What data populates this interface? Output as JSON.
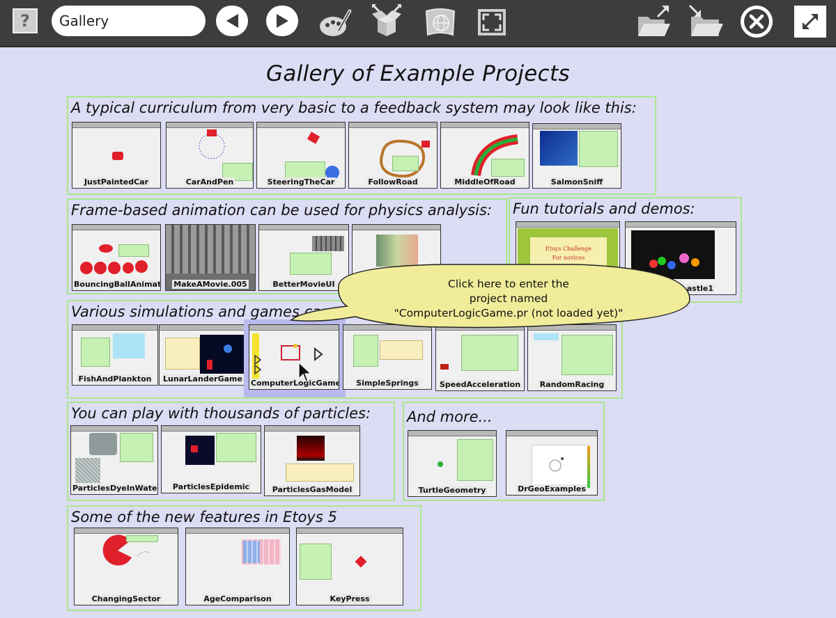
{
  "toolbar": {
    "help_label": "?",
    "project_title": "Gallery",
    "colors": {
      "background": "#3d3d3d",
      "button_fill": "#ffffff",
      "icon": "#d8d8d8"
    }
  },
  "page": {
    "title": "Gallery of Example Projects",
    "background": "#dcdcf4",
    "section_border": "#a7e88c"
  },
  "sections": [
    {
      "heading": "A typical curriculum from very basic to a feedback system may look like this:",
      "projects": [
        "JustPaintedCar",
        "CarAndPen",
        "SteeringTheCar",
        "FollowRoad",
        "MiddleOfRoad",
        "SalmonSniff"
      ]
    },
    {
      "heading": "Frame-based animation can be used for physics analysis:",
      "projects": [
        "BouncingBallAnimation",
        "MakeAMovie.005",
        "BetterMovieUI",
        ""
      ]
    },
    {
      "heading": "Fun tutorials and demos:",
      "projects": [
        "",
        "astle1"
      ],
      "slide_text": [
        "Etoys Challenge",
        "For novices"
      ]
    },
    {
      "heading": "Various simulations and games can a",
      "projects": [
        "FishAndPlankton",
        "LunarLanderGame",
        "ComputerLogicGame",
        "SimpleSprings",
        "SpeedAcceleration",
        "RandomRacing"
      ]
    },
    {
      "heading": "You can play with thousands of particles:",
      "projects": [
        "ParticlesDyeInWater",
        "ParticlesEpidemic",
        "ParticlesGasModel"
      ]
    },
    {
      "heading": "And more...",
      "projects": [
        "TurtleGeometry",
        "DrGeoExamples"
      ]
    },
    {
      "heading": "Some of the new features in Etoys 5",
      "projects": [
        "ChangingSector",
        "AgeComparison",
        "KeyPress"
      ]
    }
  ],
  "tooltip": {
    "lines": [
      "Click here to enter the",
      "project named",
      "\"ComputerLogicGame.pr (not loaded yet)\""
    ],
    "fill": "#f0ec9a"
  }
}
